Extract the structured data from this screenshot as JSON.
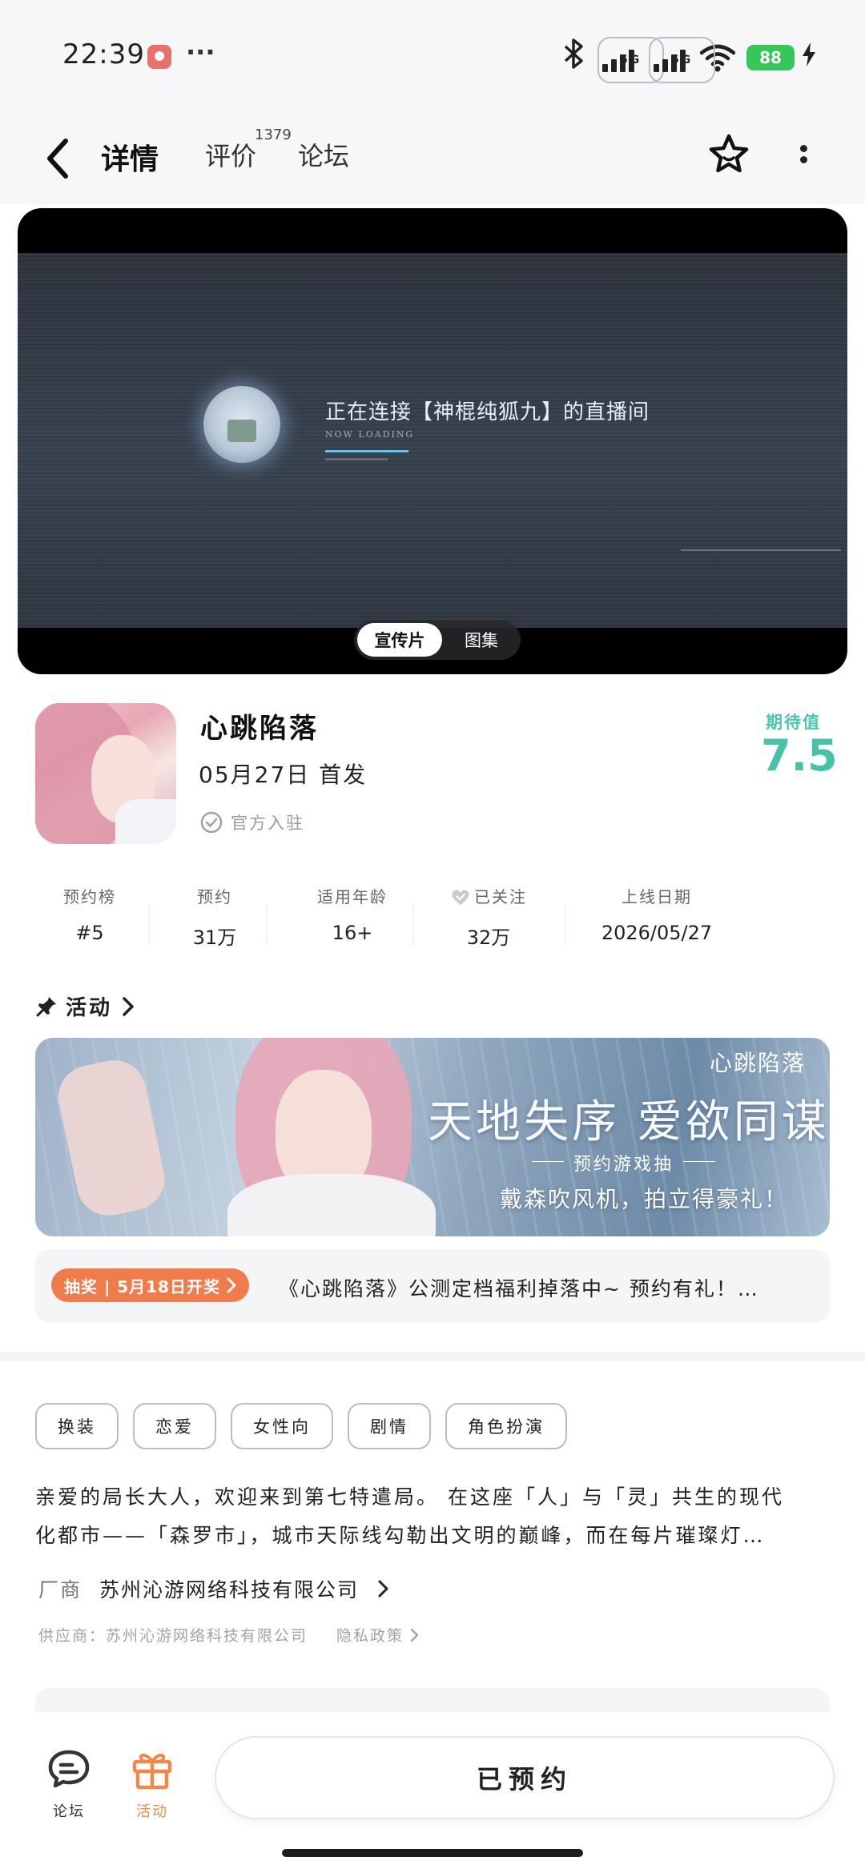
{
  "status_bar": {
    "time": "22:39",
    "more": "···",
    "network_left": "5G",
    "network_right": "5G",
    "battery": "88",
    "icons": [
      "notification-app-icon",
      "bluetooth-icon",
      "signal-icon",
      "wifi-icon",
      "charging-icon"
    ]
  },
  "nav": {
    "tabs": [
      {
        "label": "详情"
      },
      {
        "label": "评价"
      },
      {
        "label": "论坛"
      }
    ],
    "review_count": "1379",
    "accent": "#56d1b5"
  },
  "media": {
    "live_title": "正在连接【神棍纯狐九】的直播间",
    "live_sub": "NOW LOADING",
    "switch": {
      "active": "宣传片",
      "inactive": "图集"
    }
  },
  "game": {
    "title": "心跳陷落",
    "release": "05月27日  首发",
    "verified": "官方入驻",
    "expect_label": "期待值",
    "expect_score": "7.5",
    "score_color": "#46c3a7"
  },
  "stats": [
    {
      "label": "预约榜",
      "value": "#5"
    },
    {
      "label": "预约",
      "value": "31万"
    },
    {
      "label": "适用年龄",
      "value": "16+"
    },
    {
      "label": "已关注",
      "value": "32万"
    },
    {
      "label": "上线日期",
      "value": "2026/05/27"
    }
  ],
  "activity": {
    "heading": "活动",
    "banner": {
      "logo": "心跳陷落",
      "slogan": "天地失序 爱欲同谋",
      "sub": "预约游戏抽",
      "gift": "戴森吹风机，拍立得豪礼！"
    },
    "lottery": {
      "badge": "抽奖 | 5月18日开奖",
      "text": "《心跳陷落》公测定档福利掉落中~ 预约有礼！…"
    },
    "badge_color": "#f07b4b"
  },
  "tags": [
    "换装",
    "恋爱",
    "女性向",
    "剧情",
    "角色扮演"
  ],
  "description": {
    "line1": "亲爱的局长大人，欢迎来到第七特遣局。 在这座「人」与「灵」共生的现代",
    "line2": "化都市——「森罗市」，城市天际线勾勒出文明的巅峰，而在每片璀璨灯…"
  },
  "maker": {
    "key": "厂商",
    "value": "苏州沁游网络科技有限公司"
  },
  "supplier": {
    "text": "供应商：苏州沁游网络科技有限公司",
    "privacy": "隐私政策"
  },
  "bottom_bar": {
    "forum_label": "论坛",
    "activity_label": "活动",
    "reserve_label": "已预约",
    "activity_color": "#f08a4b"
  }
}
